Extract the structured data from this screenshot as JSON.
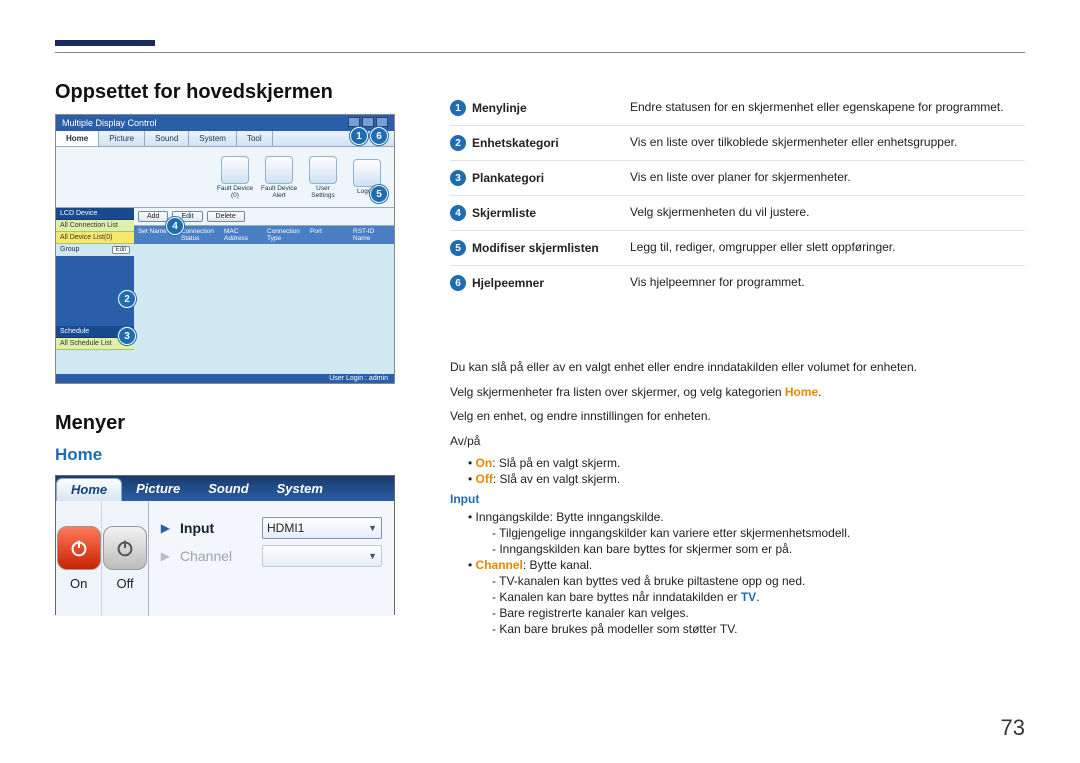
{
  "header": {
    "h1": "Oppsettet for hovedskjermen"
  },
  "mdc_window": {
    "title": "Multiple Display Control",
    "tabs": [
      "Home",
      "Picture",
      "Sound",
      "System",
      "Tool"
    ],
    "toolbar": [
      {
        "label": "Fault Device (0)"
      },
      {
        "label": "Fault Device Alert"
      },
      {
        "label": "User Settings"
      },
      {
        "label": "Logout"
      }
    ],
    "main_buttons": [
      "Add",
      "Edit",
      "Delete"
    ],
    "grid_headers": [
      "Set Name",
      "Connection Status",
      "MAC Address",
      "Connection Type",
      "Port",
      "RST-ID Name"
    ],
    "sidebar": {
      "section1": "LCD Device",
      "item1": "All Connection List",
      "item2": "All Device List(0)",
      "group": "Group",
      "group_btn": "Edit",
      "section2": "Schedule",
      "item3": "All Schedule List"
    },
    "status": "User Login : admin"
  },
  "legend": [
    {
      "num": "1",
      "label": "Menylinje",
      "desc": "Endre statusen for en skjermenhet eller egenskapene for programmet."
    },
    {
      "num": "2",
      "label": "Enhetskategori",
      "desc": "Vis en liste over tilkoblede skjermenheter eller enhetsgrupper."
    },
    {
      "num": "3",
      "label": "Plankategori",
      "desc": "Vis en liste over planer for skjermenheter."
    },
    {
      "num": "4",
      "label": "Skjermliste",
      "desc": "Velg skjermenheten du vil justere."
    },
    {
      "num": "5",
      "label": "Modifiser skjermlisten",
      "desc": "Legg til, rediger, omgrupper eller slett oppføringer."
    },
    {
      "num": "6",
      "label": "Hjelpeemner",
      "desc": "Vis hjelpeemner for programmet."
    }
  ],
  "menus": {
    "h1": "Menyer",
    "home_h": "Home",
    "p1": "Du kan slå på eller av en valgt enhet eller endre inndatakilden eller volumet for enheten.",
    "p2_a": "Velg skjermenheter fra listen over skjermer, og velg kategorien ",
    "p2_home": "Home",
    "p2_b": ".",
    "p3": "Velg en enhet, og endre innstillingen for enheten.",
    "avpa": "Av/på",
    "on_label": "On",
    "on_text": ": Slå på en valgt skjerm.",
    "off_label": "Off",
    "off_text": ": Slå av en valgt skjerm.",
    "input_h": "Input",
    "input1_a": "Inngangskilde: Bytte inngangskilde.",
    "input1_s1": "Tilgjengelige inngangskilder kan variere etter skjermenhetsmodell.",
    "input1_s2": "Inngangskilden kan bare byttes for skjermer som er på.",
    "channel_label": "Channel",
    "channel_text": ": Bytte kanal.",
    "ch_s1": "TV-kanalen kan byttes ved å bruke piltastene opp og ned.",
    "ch_s2_a": "Kanalen kan bare byttes når inndatakilden er ",
    "ch_s2_tv": "TV",
    "ch_s2_b": ".",
    "ch_s3": "Bare registrerte kanaler kan velges.",
    "ch_s4": "Kan bare brukes på modeller som støtter TV."
  },
  "home_panel": {
    "tabs": [
      "Home",
      "Picture",
      "Sound",
      "System"
    ],
    "on": "On",
    "off": "Off",
    "input_label": "Input",
    "input_value": "HDMI1",
    "channel_label": "Channel"
  },
  "page_number": "73"
}
